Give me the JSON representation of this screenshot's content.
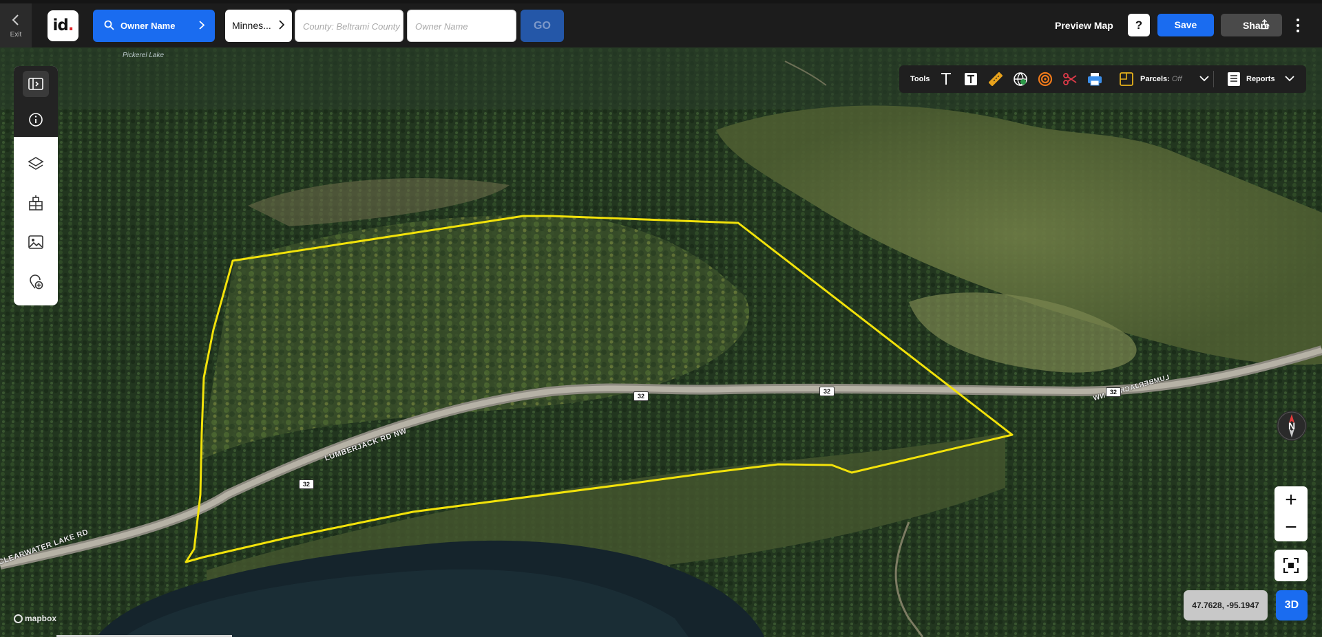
{
  "header": {
    "exit_label": "Exit",
    "logo_text": "id",
    "search_mode_label": "Owner Name",
    "state_label": "Minnes...",
    "county_placeholder": "County: Beltrami County",
    "owner_placeholder": "Owner Name",
    "go_label": "GO",
    "preview_label": "Preview Map",
    "help_label": "?",
    "save_label": "Save",
    "share_label": "Share"
  },
  "tools": {
    "label": "Tools",
    "parcels_label": "Parcels:",
    "parcels_state": "Off",
    "reports_label": "Reports",
    "icons": [
      "text-icon",
      "text-box-icon",
      "ruler-icon",
      "globe-icon",
      "radius-icon",
      "scissors-icon",
      "print-icon",
      "parcel-layer-icon"
    ]
  },
  "left_toolbar": {
    "icons": [
      "sidebar-toggle-icon",
      "info-icon",
      "layers-icon",
      "buildings-icon",
      "image-icon",
      "add-location-icon"
    ]
  },
  "map": {
    "place_label": "Pickerel Lake",
    "roads": [
      {
        "name": "LUMBERJACK RD NW"
      },
      {
        "name": "LUMBERJACK RD NW"
      },
      {
        "name": "CLEARWATER LAKE RD"
      }
    ],
    "route_shield": "32",
    "compass_label": "N",
    "zoom_in": "+",
    "zoom_out": "−",
    "coordinates": "47.7628, -95.1947",
    "view_mode": "3D",
    "attribution": "mapbox",
    "colors": {
      "parcel_outline": "#f2e20a",
      "accent": "#1a6cf0"
    }
  }
}
